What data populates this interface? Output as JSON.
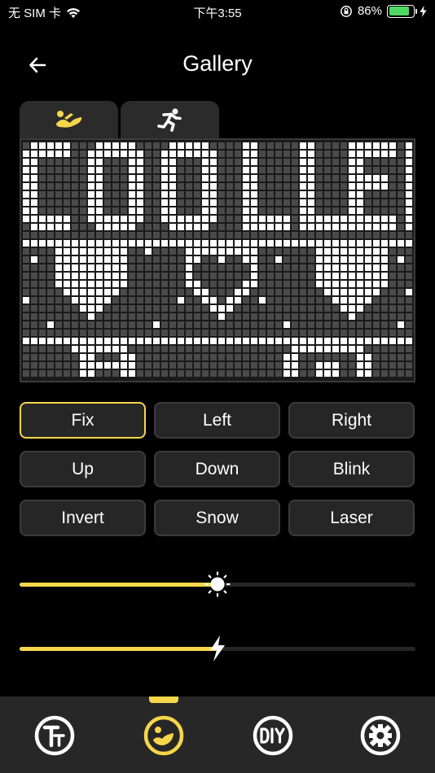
{
  "status_bar": {
    "carrier": "无 SIM 卡",
    "time": "下午3:55",
    "battery": "86%",
    "battery_level": 0.86
  },
  "header": {
    "title": "Gallery"
  },
  "tabs": [
    {
      "icon": "lying-person-icon",
      "active": true
    },
    {
      "icon": "running-person-icon",
      "active": false
    }
  ],
  "led_display": {
    "text_line1": "COOLLED",
    "text_line2": "hearts",
    "lit_color": "#ffffff",
    "unlit_color": "#4a4a4a"
  },
  "modes": [
    {
      "label": "Fix",
      "active": true
    },
    {
      "label": "Left",
      "active": false
    },
    {
      "label": "Right",
      "active": false
    },
    {
      "label": "Up",
      "active": false
    },
    {
      "label": "Down",
      "active": false
    },
    {
      "label": "Blink",
      "active": false
    },
    {
      "label": "Invert",
      "active": false
    },
    {
      "label": "Snow",
      "active": false
    },
    {
      "label": "Laser",
      "active": false
    }
  ],
  "sliders": {
    "brightness": {
      "icon": "sun-icon",
      "value": 0.5
    },
    "speed": {
      "icon": "lightning-icon",
      "value": 0.5
    }
  },
  "bottom_nav": [
    {
      "icon": "text-icon",
      "active": false
    },
    {
      "icon": "gallery-icon",
      "active": true
    },
    {
      "icon": "diy-icon",
      "active": false
    },
    {
      "icon": "settings-icon",
      "active": false
    }
  ],
  "colors": {
    "accent": "#f6d64a",
    "background": "#000000",
    "panel": "#262626"
  }
}
